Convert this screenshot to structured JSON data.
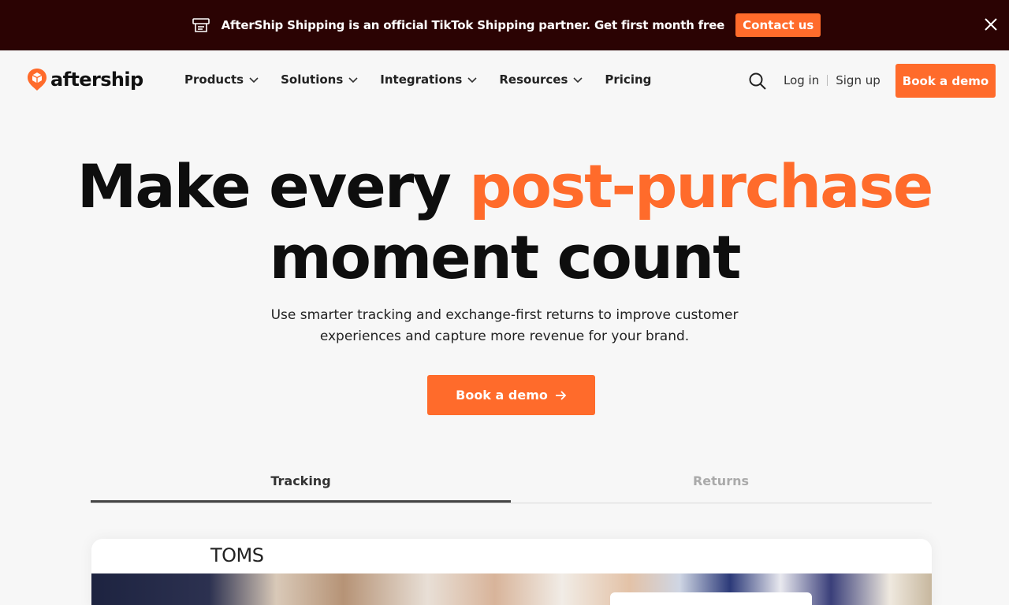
{
  "announcement": {
    "text": "AfterShip Shipping is an official TikTok Shipping partner. Get first month free",
    "cta": "Contact us",
    "icon": "printer-icon",
    "close_icon": "close-icon"
  },
  "nav": {
    "logo_text": "aftership",
    "menu": [
      {
        "label": "Products",
        "has_dropdown": true
      },
      {
        "label": "Solutions",
        "has_dropdown": true
      },
      {
        "label": "Integrations",
        "has_dropdown": true
      },
      {
        "label": "Resources",
        "has_dropdown": true
      },
      {
        "label": "Pricing",
        "has_dropdown": false
      }
    ],
    "login": "Log in",
    "signup": "Sign up",
    "demo_button": "Book a demo"
  },
  "hero": {
    "title_part1": "Make every ",
    "title_accent": "post-purchase",
    "title_part2": "moment count",
    "subtitle": "Use smarter tracking and exchange-first returns to improve customer experiences and capture more revenue for your brand.",
    "cta": "Book a demo"
  },
  "tabs": [
    {
      "label": "Tracking",
      "active": true
    },
    {
      "label": "Returns",
      "active": false
    }
  ],
  "preview": {
    "brand": "TOMS"
  },
  "colors": {
    "accent": "#ff6b2b",
    "announcement_bg": "#2b0303",
    "page_bg": "#f7f7f7"
  }
}
